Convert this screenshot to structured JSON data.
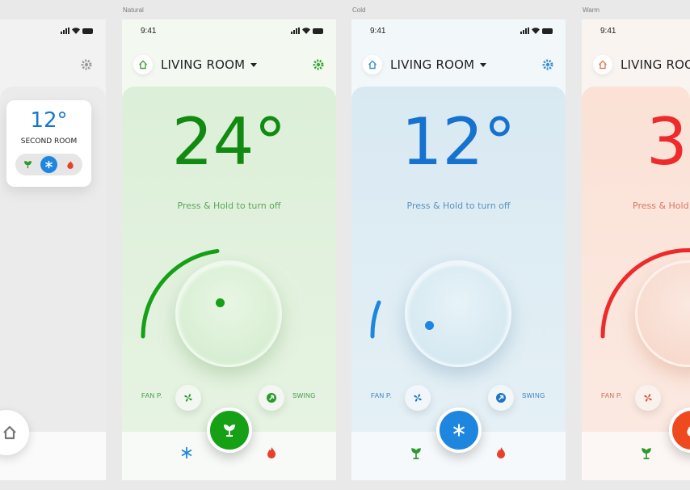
{
  "frames": [
    {
      "label": "Natural"
    },
    {
      "label": "Cold"
    },
    {
      "label": "Warm"
    }
  ],
  "status": {
    "time": "9:41"
  },
  "room": {
    "title": "LIVING ROOM"
  },
  "hint": "Press & Hold to turn off",
  "natural": {
    "temp": "24°",
    "fan_label": "FAN P.",
    "swing_label": "SWING",
    "accent": "#15a015",
    "level": 0.45
  },
  "cold": {
    "temp": "12°",
    "fan_label": "FAN P.",
    "swing_label": "SWING",
    "accent": "#1f86e0",
    "level": 0.1
  },
  "warm": {
    "temp": "3",
    "fan_label": "FAN P.",
    "accent": "#ee2a2a",
    "level": 0.6
  },
  "second_room": {
    "temp": "12°",
    "name": "SECOND ROOM"
  },
  "icons": {
    "home": "home-icon",
    "gear": "gear-icon",
    "fan": "fan-icon",
    "swing": "swing-icon",
    "snow": "snowflake-icon",
    "leaf": "plant-icon",
    "flame": "flame-icon"
  }
}
